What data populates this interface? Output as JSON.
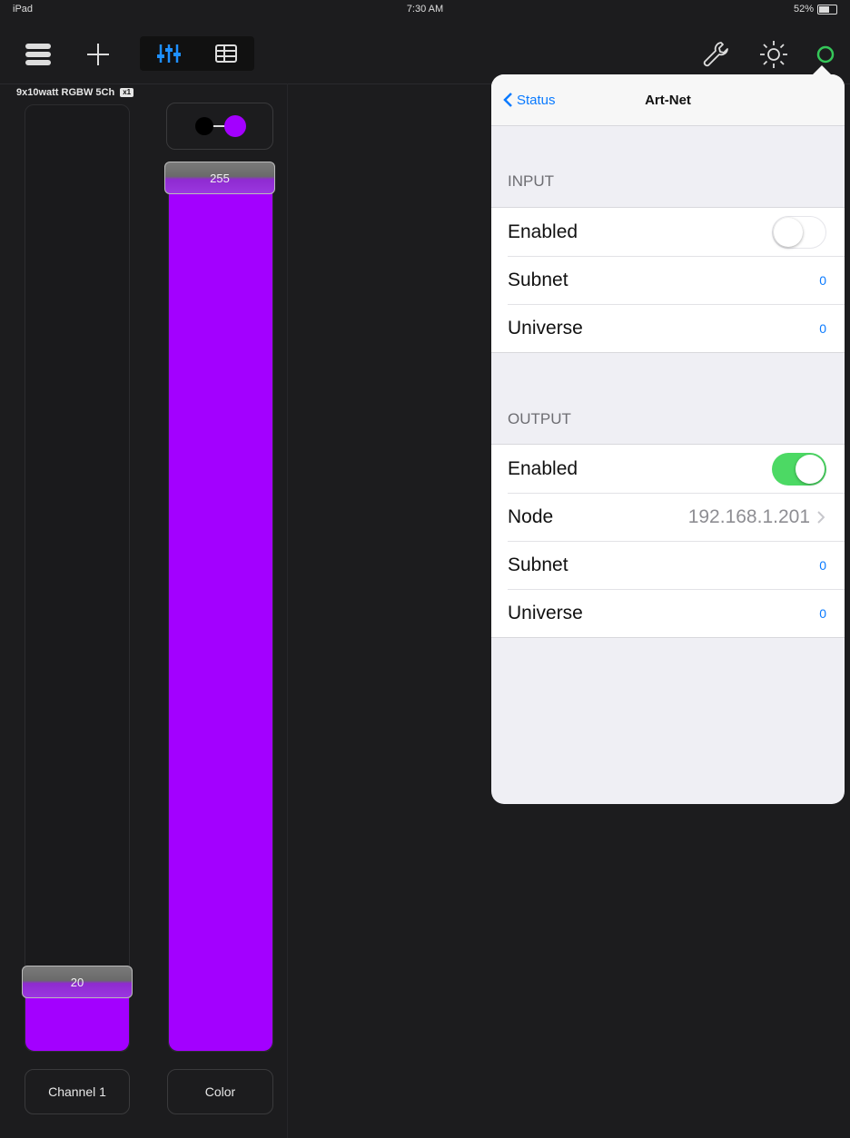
{
  "status_bar": {
    "device": "iPad",
    "time": "7:30 AM",
    "battery": "52%"
  },
  "fixture": {
    "name": "9x10watt RGBW 5Ch",
    "badge": "x1",
    "channels": [
      {
        "label": "Channel 1",
        "value": "20",
        "level": 0.078
      },
      {
        "label": "Color",
        "value": "255",
        "level": 1.0
      }
    ],
    "color_toggle": {
      "left_color": "#000000",
      "right_color": "#a300ff"
    }
  },
  "colors": {
    "fader_fill": "#a300ff",
    "accent_blue": "#0a7aff",
    "toggle_on": "#4cd964",
    "status_green": "#35c759"
  },
  "icons": [
    "layers-icon",
    "plus-icon",
    "sliders-icon",
    "grid-icon",
    "wrench-icon",
    "sun-icon",
    "status-circle-icon"
  ],
  "popover": {
    "back_label": "Status",
    "title": "Art-Net",
    "input": {
      "header": "INPUT",
      "enabled_label": "Enabled",
      "enabled": false,
      "subnet_label": "Subnet",
      "subnet_value": "0",
      "universe_label": "Universe",
      "universe_value": "0"
    },
    "output": {
      "header": "OUTPUT",
      "enabled_label": "Enabled",
      "enabled": true,
      "node_label": "Node",
      "node_value": "192.168.1.201",
      "subnet_label": "Subnet",
      "subnet_value": "0",
      "universe_label": "Universe",
      "universe_value": "0"
    }
  }
}
